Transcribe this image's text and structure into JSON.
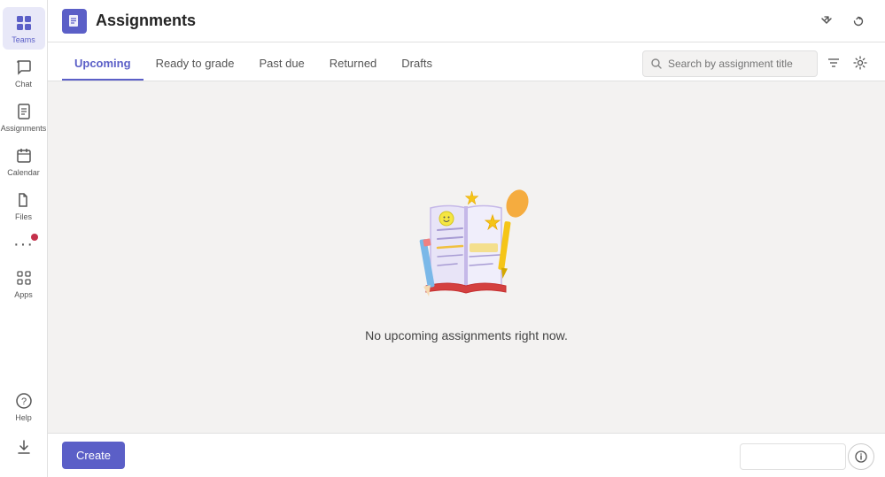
{
  "app": {
    "title": "Assignments"
  },
  "sidebar": {
    "items": [
      {
        "id": "chat",
        "label": "Chat",
        "icon": "💬",
        "active": false
      },
      {
        "id": "teams",
        "label": "Teams",
        "icon": "👥",
        "active": true
      },
      {
        "id": "assignments",
        "label": "Assignments",
        "icon": "📋",
        "active": false
      },
      {
        "id": "calendar",
        "label": "Calendar",
        "icon": "📅",
        "active": false
      },
      {
        "id": "files",
        "label": "Files",
        "icon": "📁",
        "active": false
      },
      {
        "id": "more",
        "label": "...",
        "icon": "•••",
        "active": false
      },
      {
        "id": "apps",
        "label": "Apps",
        "icon": "⊞",
        "active": false
      }
    ],
    "bottom": [
      {
        "id": "help",
        "label": "Help",
        "icon": "?"
      },
      {
        "id": "download",
        "label": "Download",
        "icon": "⬇"
      }
    ]
  },
  "header": {
    "icon": "📋",
    "title": "Assignments",
    "minimize_label": "minimize",
    "refresh_label": "refresh"
  },
  "tabs": [
    {
      "id": "upcoming",
      "label": "Upcoming",
      "active": true
    },
    {
      "id": "ready-to-grade",
      "label": "Ready to grade",
      "active": false
    },
    {
      "id": "past-due",
      "label": "Past due",
      "active": false
    },
    {
      "id": "returned",
      "label": "Returned",
      "active": false
    },
    {
      "id": "drafts",
      "label": "Drafts",
      "active": false
    }
  ],
  "search": {
    "placeholder": "Search by assignment title",
    "label": "Search assignment"
  },
  "empty_state": {
    "message": "No upcoming assignments right now."
  },
  "bottom": {
    "create_label": "Create",
    "info_icon": "ℹ"
  }
}
